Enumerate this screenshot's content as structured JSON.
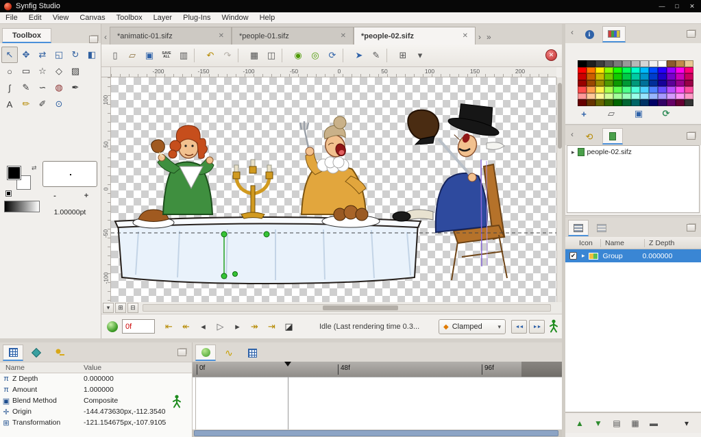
{
  "theme": {
    "accent": "#4a90d9",
    "selection": "#3a86d4",
    "time_text": "#cc0000",
    "checker": "#cfcfcf",
    "scroll_thumb": "#8ca4c5"
  },
  "window": {
    "title": "Synfig Studio"
  },
  "icons": {
    "minimize": "—",
    "maximize": "□",
    "close": "✕",
    "chevron_left": "‹",
    "chevron_right": "›",
    "chevron_right2": "»",
    "tab_close": "✕",
    "dropdown": "▾",
    "expander": "▸",
    "check": "✔",
    "info": "i",
    "history": "⟲",
    "curves": "∿",
    "diamond": "◆",
    "swap": "⇄",
    "stop": "✕",
    "past_onion": "◄◄",
    "future_onion": "►►"
  },
  "menubar": {
    "items": [
      "File",
      "Edit",
      "View",
      "Canvas",
      "Toolbox",
      "Layer",
      "Plug-Ins",
      "Window",
      "Help"
    ]
  },
  "toolbox": {
    "tab_label": "Toolbox",
    "tools": [
      {
        "name": "transform-tool",
        "glyph": "↖",
        "color": "#2f5fa0"
      },
      {
        "name": "smooth-move-tool",
        "glyph": "✥",
        "color": "#2f5fa0"
      },
      {
        "name": "mirror-tool",
        "glyph": "⇄",
        "color": "#2f5fa0"
      },
      {
        "name": "scale-tool",
        "glyph": "◱",
        "color": "#2f5fa0"
      },
      {
        "name": "rotate-tool",
        "glyph": "↻",
        "color": "#2f5fa0"
      },
      {
        "name": "width-tool",
        "glyph": "◧",
        "color": "#2f5fa0"
      },
      {
        "name": "circle-tool",
        "glyph": "○",
        "color": "#3a3a3a"
      },
      {
        "name": "rectangle-tool",
        "glyph": "▭",
        "color": "#3a3a3a"
      },
      {
        "name": "star-tool",
        "glyph": "☆",
        "color": "#3a3a3a"
      },
      {
        "name": "polygon-tool",
        "glyph": "◇",
        "color": "#3a3a3a"
      },
      {
        "name": "gradient-tool",
        "glyph": "▨",
        "color": "#3a3a3a"
      },
      {
        "name": "spacer",
        "glyph": "",
        "inter": "false",
        "cls": "spacer"
      },
      {
        "name": "spline-tool",
        "glyph": "ʃ",
        "color": "#3a3a3a"
      },
      {
        "name": "draw-tool",
        "glyph": "✎",
        "color": "#3a3a3a"
      },
      {
        "name": "lasso-tool",
        "glyph": "∽",
        "color": "#3a3a3a"
      },
      {
        "name": "fill-tool",
        "glyph": "◍",
        "color": "#8a2f2f"
      },
      {
        "name": "eyedrop-tool",
        "glyph": "✒",
        "color": "#3a3a3a"
      },
      {
        "name": "spacer",
        "glyph": "",
        "inter": "false",
        "cls": "spacer"
      },
      {
        "name": "text-tool",
        "glyph": "A",
        "color": "#3a3a3a"
      },
      {
        "name": "sketch-tool",
        "glyph": "✏",
        "color": "#b58900"
      },
      {
        "name": "brush-tool",
        "glyph": "✐",
        "color": "#3a3a3a"
      },
      {
        "name": "zoom-tool",
        "glyph": "⊙",
        "color": "#2f5fa0"
      }
    ],
    "fg_color": "#000000",
    "bg_color": "#ffffff",
    "decrease": "-",
    "increase": "+",
    "brush_size": "1.00000pt"
  },
  "canvas": {
    "tabs": [
      {
        "label": "*animatic-01.sifz"
      },
      {
        "label": "*people-01.sifz"
      },
      {
        "label": "*people-02.sifz"
      }
    ],
    "toolbar": [
      {
        "name": "new-document-button",
        "glyph": "▯",
        "color": "#555"
      },
      {
        "name": "open-document-button",
        "glyph": "▱",
        "color": "#8a6d3b"
      },
      {
        "name": "save-document-button",
        "glyph": "▣",
        "color": "#2f62a8"
      },
      {
        "name": "save-all-button",
        "glyph": "SAVE ALL",
        "color": "#333",
        "cls": "tiny"
      },
      {
        "name": "revert-document-button",
        "glyph": "▥",
        "color": "#555"
      },
      {
        "name": "separator",
        "cls": "sep",
        "inter": "false"
      },
      {
        "name": "undo-button",
        "glyph": "↶",
        "color": "#b58900"
      },
      {
        "name": "redo-button",
        "glyph": "↷",
        "color": "#b3ada5"
      },
      {
        "name": "separator",
        "cls": "sep",
        "inter": "false"
      },
      {
        "name": "render-options-button",
        "glyph": "▦",
        "color": "#555"
      },
      {
        "name": "preview-button",
        "glyph": "◫",
        "color": "#555"
      },
      {
        "name": "separator",
        "cls": "sep",
        "inter": "false"
      },
      {
        "name": "onion-skin-toggle",
        "glyph": "◉",
        "color": "#4e9a06"
      },
      {
        "name": "background-render-toggle",
        "glyph": "◎",
        "color": "#4e9a06"
      },
      {
        "name": "refresh-canvas-button",
        "glyph": "⟳",
        "color": "#2f62a8"
      },
      {
        "name": "separator",
        "cls": "sep",
        "inter": "false"
      },
      {
        "name": "mask-position-ducks",
        "glyph": "➤",
        "color": "#2f62a8"
      },
      {
        "name": "mask-vertex-ducks",
        "glyph": "✎",
        "color": "#555"
      },
      {
        "name": "separator",
        "cls": "sep",
        "inter": "false"
      },
      {
        "name": "toggle-grid-button",
        "glyph": "⊞",
        "color": "#555"
      },
      {
        "name": "grid-menu-button",
        "glyph": "▾",
        "color": "#555"
      }
    ],
    "hruler": [
      "-200",
      "-150",
      "-100",
      "-50",
      "0",
      "50",
      "100",
      "150",
      "200"
    ],
    "vruler": [
      "100",
      "50",
      "0",
      "-50",
      "-100"
    ],
    "corner_buttons": [
      {
        "name": "canvas-window-menu",
        "glyph": "▾"
      },
      {
        "name": "past-keyframe-lock",
        "glyph": "⊞"
      },
      {
        "name": "future-keyframe-lock",
        "glyph": "⊟"
      }
    ],
    "playback": [
      {
        "name": "seek-begin-button",
        "glyph": "⇤",
        "color": "#b58900"
      },
      {
        "name": "prev-keyframe-button",
        "glyph": "↞",
        "color": "#b58900"
      },
      {
        "name": "prev-frame-button",
        "glyph": "◂",
        "color": "#444"
      },
      {
        "name": "play-button",
        "glyph": "▷",
        "color": "#666"
      },
      {
        "name": "next-frame-button",
        "glyph": "▸",
        "color": "#444"
      },
      {
        "name": "next-keyframe-button",
        "glyph": "↠",
        "color": "#b58900"
      },
      {
        "name": "seek-end-button",
        "glyph": "⇥",
        "color": "#b58900"
      },
      {
        "name": "time-bounds-button",
        "glyph": "◪",
        "color": "#333"
      }
    ],
    "time_value": "0f",
    "status": "Idle (Last rendering time 0.3...",
    "interpolation": {
      "label": "Clamped"
    }
  },
  "palette": {
    "columns": 13,
    "colors": [
      "#000000",
      "#1f1f1f",
      "#3d3d3d",
      "#5c5c5c",
      "#7a7a7a",
      "#999999",
      "#b8b8b8",
      "#d6d6d6",
      "#f0f0f0",
      "#ffffff",
      "#8c5a2b",
      "#c18a4a",
      "#e8c893",
      "#ff0000",
      "#ff7700",
      "#ffea00",
      "#88ff00",
      "#15ff00",
      "#00ff59",
      "#00ffcc",
      "#00bbff",
      "#004cff",
      "#2600ff",
      "#9900ff",
      "#ff00ea",
      "#ff0077",
      "#cc0000",
      "#cc5f00",
      "#ccbb00",
      "#6dcc00",
      "#11cc00",
      "#00cc47",
      "#00cca3",
      "#0096cc",
      "#003dcc",
      "#1e00cc",
      "#7a00cc",
      "#cc00bb",
      "#cc005f",
      "#990000",
      "#994700",
      "#998c00",
      "#529900",
      "#0d9900",
      "#009935",
      "#00997a",
      "#007099",
      "#002e99",
      "#170099",
      "#5c0099",
      "#99008c",
      "#990047",
      "#ff4d4d",
      "#ff9f4d",
      "#fff04d",
      "#acff4d",
      "#5bff4d",
      "#4dff8b",
      "#4dffdb",
      "#4dd1ff",
      "#4d82ff",
      "#664dff",
      "#b84dff",
      "#ff4df0",
      "#ff4da0",
      "#ff9999",
      "#ffc999",
      "#fff799",
      "#d3ff99",
      "#a3ff99",
      "#99ffbc",
      "#99ffe9",
      "#99e4ff",
      "#99b6ff",
      "#a899ff",
      "#d699ff",
      "#ff99f7",
      "#ff99c6",
      "#660000",
      "#663300",
      "#666600",
      "#336600",
      "#006600",
      "#006633",
      "#006666",
      "#003366",
      "#000066",
      "#330066",
      "#660066",
      "#660033",
      "#333333"
    ],
    "actions": [
      {
        "name": "add-color-button",
        "glyph": "+",
        "color": "#2f62a8"
      },
      {
        "name": "open-palette-button",
        "glyph": "▱",
        "color": "#555"
      },
      {
        "name": "save-palette-button",
        "glyph": "▣",
        "color": "#2f62a8"
      },
      {
        "name": "refresh-palette-button",
        "glyph": "⟳",
        "color": "#2e8b57"
      }
    ]
  },
  "library": {
    "items": [
      {
        "label": "people-02.sifz"
      }
    ]
  },
  "layers": {
    "headers": [
      "Icon",
      "Name",
      "Z Depth"
    ],
    "rows": [
      {
        "name": "Group",
        "z_depth": "0.000000"
      }
    ],
    "actions": [
      {
        "name": "raise-layer-button",
        "glyph": "▲",
        "color": "#2e8b2e"
      },
      {
        "name": "lower-layer-button",
        "glyph": "▼",
        "color": "#2e8b2e"
      },
      {
        "name": "new-layer-button",
        "glyph": "▤",
        "color": "#555"
      },
      {
        "name": "new-group-button",
        "glyph": "▦",
        "color": "#555"
      },
      {
        "name": "delete-layer-button",
        "glyph": "▬",
        "color": "#555"
      },
      {
        "name": "layers-menu-button",
        "glyph": "▾",
        "color": "#333"
      }
    ]
  },
  "params": {
    "headers": [
      "Name",
      "Value"
    ],
    "rows": [
      {
        "icon": "π",
        "name": "Z Depth",
        "value": "0.000000"
      },
      {
        "icon": "π",
        "name": "Amount",
        "value": "1.000000"
      },
      {
        "icon": "▣",
        "name": "Blend Method",
        "value": "Composite"
      },
      {
        "icon": "✛",
        "name": "Origin",
        "value": "-144.473630px,-112.3540"
      },
      {
        "icon": "⊞",
        "name": "Transformation",
        "value": "-121.154675px,-107.9105"
      }
    ]
  },
  "timetrack": {
    "labels": [
      "0f",
      "48f",
      "96f"
    ]
  }
}
